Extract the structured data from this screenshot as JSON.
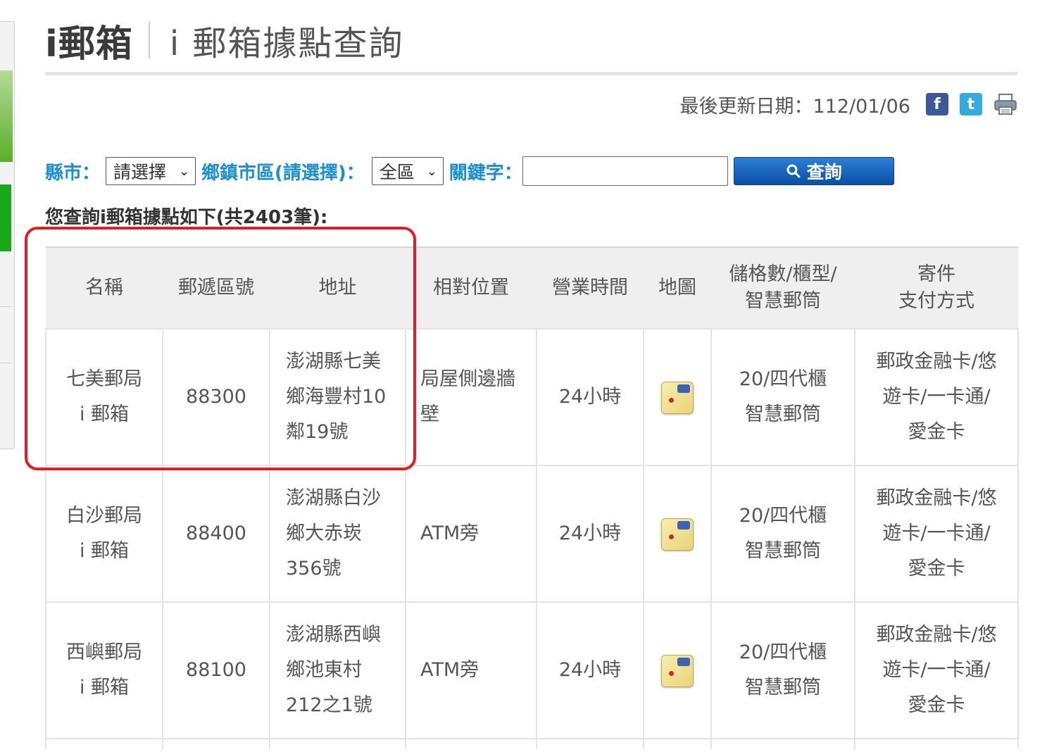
{
  "title": {
    "main": "i郵箱",
    "sub": "i 郵箱據點查詢"
  },
  "update": {
    "label": "最後更新日期：112/01/06"
  },
  "share": {
    "facebook_glyph": "f",
    "twitter_glyph": "t"
  },
  "search": {
    "county_label": "縣市：",
    "county_value": "請選擇",
    "district_label": "鄉鎮市區(請選擇)：",
    "district_value": "全區",
    "keyword_label": "關鍵字：",
    "keyword_value": "",
    "button_label": "查詢"
  },
  "result_summary": "您查詢i郵箱據點如下(共2403筆):",
  "table": {
    "headers": {
      "name": "名稱",
      "zip": "郵遞區號",
      "address": "地址",
      "position": "相對位置",
      "hours": "營業時間",
      "map": "地圖",
      "cells_1": "儲格數/櫃型/",
      "cells_2": "智慧郵筒",
      "pay_1": "寄件",
      "pay_2": "支付方式"
    },
    "rows": [
      {
        "name_1": "七美郵局",
        "name_2": "i 郵箱",
        "zip": "88300",
        "addr_1": "澎湖縣七美",
        "addr_2": "鄉海豐村10",
        "addr_3": "鄰19號",
        "position_1": "局屋側邊牆",
        "position_2": "壁",
        "hours": "24小時",
        "cells_1": "20/四代櫃",
        "cells_2": "智慧郵筒",
        "pay_1": "郵政金融卡/悠",
        "pay_2": "遊卡/一卡通/",
        "pay_3": "愛金卡"
      },
      {
        "name_1": "白沙郵局",
        "name_2": "i 郵箱",
        "zip": "88400",
        "addr_1": "澎湖縣白沙",
        "addr_2": "鄉大赤崁",
        "addr_3": "356號",
        "position_1": "ATM旁",
        "position_2": "",
        "hours": "24小時",
        "cells_1": "20/四代櫃",
        "cells_2": "智慧郵筒",
        "pay_1": "郵政金融卡/悠",
        "pay_2": "遊卡/一卡通/",
        "pay_3": "愛金卡"
      },
      {
        "name_1": "西嶼郵局",
        "name_2": "i 郵箱",
        "zip": "88100",
        "addr_1": "澎湖縣西嶼",
        "addr_2": "鄉池東村",
        "addr_3": "212之1號",
        "position_1": "ATM旁",
        "position_2": "",
        "hours": "24小時",
        "cells_1": "20/四代櫃",
        "cells_2": "智慧郵筒",
        "pay_1": "郵政金融卡/悠",
        "pay_2": "遊卡/一卡通/",
        "pay_3": "愛金卡"
      }
    ]
  },
  "colors": {
    "label_blue": "#1a8fd1",
    "button_blue": "#0b4fa6",
    "highlight_red": "#e31b23",
    "header_bg": "#efefef"
  }
}
